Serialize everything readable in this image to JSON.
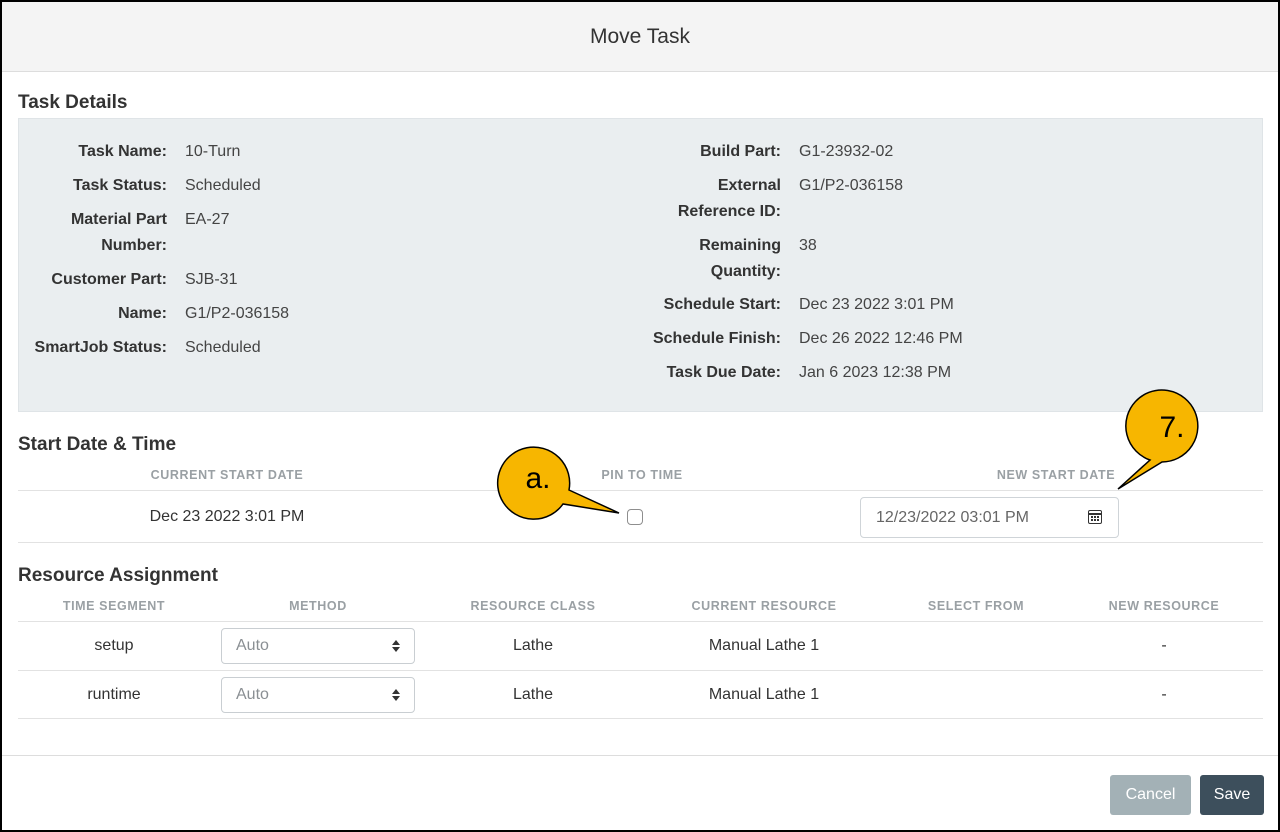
{
  "modal": {
    "title": "Move Task"
  },
  "task_details": {
    "title": "Task Details",
    "left": [
      {
        "label": "Task Name:",
        "value": "10-Turn"
      },
      {
        "label": "Task Status:",
        "value": "Scheduled"
      },
      {
        "label": "Material Part Number:",
        "value": "EA-27"
      },
      {
        "label": "Customer Part:",
        "value": "SJB-31"
      },
      {
        "label": "Name:",
        "value": "G1/P2-036158"
      },
      {
        "label": "SmartJob Status:",
        "value": "Scheduled"
      }
    ],
    "right": [
      {
        "label": "Build Part:",
        "value": "G1-23932-02"
      },
      {
        "label": "External Reference ID:",
        "value": "G1/P2-036158"
      },
      {
        "label": "Remaining Quantity:",
        "value": "38"
      },
      {
        "label": "Schedule Start:",
        "value": "Dec 23 2022 3:01 PM"
      },
      {
        "label": "Schedule Finish:",
        "value": "Dec 26 2022 12:46 PM"
      },
      {
        "label": "Task Due Date:",
        "value": "Jan 6 2023 12:38 PM"
      }
    ]
  },
  "start_date": {
    "title": "Start Date & Time",
    "headers": {
      "current": "CURRENT START DATE",
      "pin": "PIN TO TIME",
      "new": "NEW START DATE"
    },
    "current_value": "Dec 23 2022 3:01 PM",
    "new_value": "12/23/2022 03:01 PM",
    "pinned": false
  },
  "resource_assignment": {
    "title": "Resource Assignment",
    "headers": [
      "TIME SEGMENT",
      "METHOD",
      "RESOURCE CLASS",
      "CURRENT RESOURCE",
      "SELECT FROM",
      "NEW RESOURCE"
    ],
    "rows": [
      {
        "segment": "setup",
        "method": "Auto",
        "resource_class": "Lathe",
        "current_resource": "Manual Lathe 1",
        "select_from": "",
        "new_resource": "-"
      },
      {
        "segment": "runtime",
        "method": "Auto",
        "resource_class": "Lathe",
        "current_resource": "Manual Lathe 1",
        "select_from": "",
        "new_resource": "-"
      }
    ]
  },
  "footer": {
    "cancel_label": "Cancel",
    "save_label": "Save"
  },
  "annotations": {
    "a_label": "a.",
    "seven_label": "7.",
    "callout_color": "#f7b600"
  },
  "colors": {
    "save": "#3d4f5c",
    "cancel": "#a3b1b6",
    "panel": "#eaeef0"
  }
}
